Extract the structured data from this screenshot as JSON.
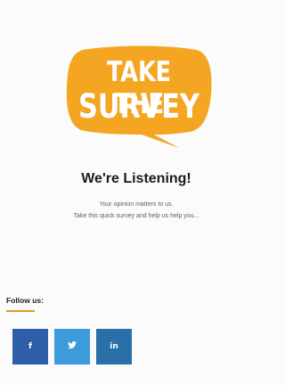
{
  "badge": {
    "line1": "TAKE THE",
    "line2": "SURVEY",
    "color": "#f4a623"
  },
  "heading": "We're Listening!",
  "subtext": {
    "line1": "Your opinion matters to us.",
    "line2": "Take this quick survey and help us help you..."
  },
  "follow": {
    "label": "Follow us:",
    "underline_color": "#e09a2b"
  },
  "social": [
    {
      "name": "facebook",
      "glyph": "f",
      "color": "#2f5ea8"
    },
    {
      "name": "twitter",
      "glyph": "t",
      "color": "#3d9bdc"
    },
    {
      "name": "linkedin",
      "glyph": "in",
      "color": "#2a6fa8"
    }
  ]
}
